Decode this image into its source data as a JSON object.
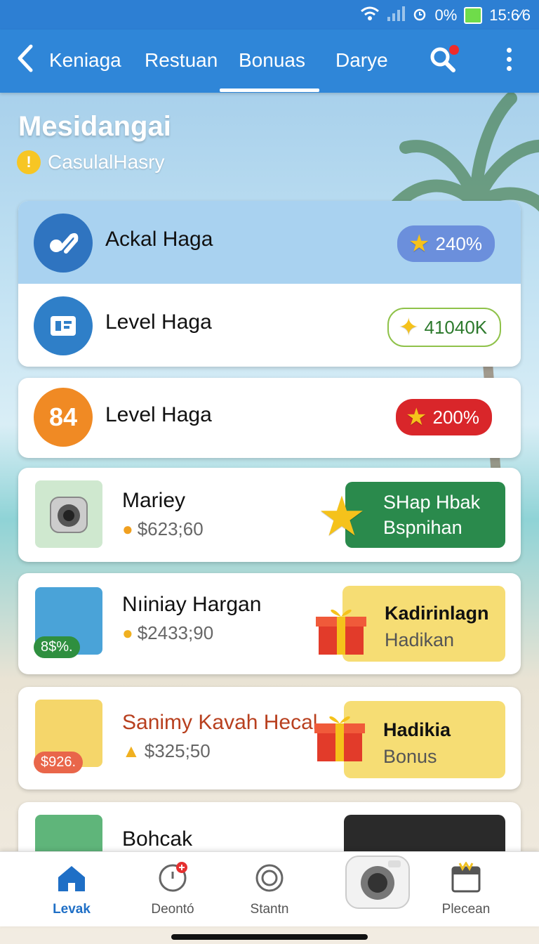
{
  "status": {
    "battery": "0%",
    "time": "15:6⁄6"
  },
  "tabs": [
    {
      "label": "Keniaga"
    },
    {
      "label": "Restuan"
    },
    {
      "label": "Bonuas",
      "active": true
    },
    {
      "label": "Darye"
    }
  ],
  "page": {
    "title": "Mesidangai",
    "subtitle": "CasulalHasry",
    "warn_glyph": "!"
  },
  "levels": [
    {
      "label": "Ackal Haga",
      "badge": "240%",
      "icon": "link-icon"
    },
    {
      "label": "Level Haga",
      "badge": "41040K",
      "icon": "document-icon"
    },
    {
      "label": "Level Haga",
      "badge": "200%",
      "circle_text": "84"
    }
  ],
  "products": [
    {
      "name": "Mariey",
      "price": "$623;60",
      "promo_line1": "SHap Hbak",
      "promo_line2": "Bspnihan"
    },
    {
      "name": "Nıiniay Hargan",
      "price": "$2433;90",
      "thumb_badge": "8$%.",
      "promo_line1": "Kadirinlagn",
      "promo_line2": "Hadikan"
    },
    {
      "name": "Sanimy Kavah Hecal",
      "price": "$325;50",
      "thumb_badge": "$926.",
      "promo_line1": "Hadikia",
      "promo_line2": "Bonus"
    },
    {
      "name": "Bohcak"
    }
  ],
  "nav": [
    {
      "label": "Levak",
      "icon": "home-icon",
      "active": true
    },
    {
      "label": "Deontó",
      "icon": "clock-icon"
    },
    {
      "label": "Stantn",
      "icon": "ring-icon"
    },
    {
      "label": "",
      "icon": "camera-icon"
    },
    {
      "label": "Plecean",
      "icon": "calendar-icon"
    }
  ],
  "colors": {
    "accent": "#2f86d8",
    "nav_active": "#1f6fc6",
    "green_promo": "#2a8a4c",
    "red_badge": "#d9262a"
  }
}
